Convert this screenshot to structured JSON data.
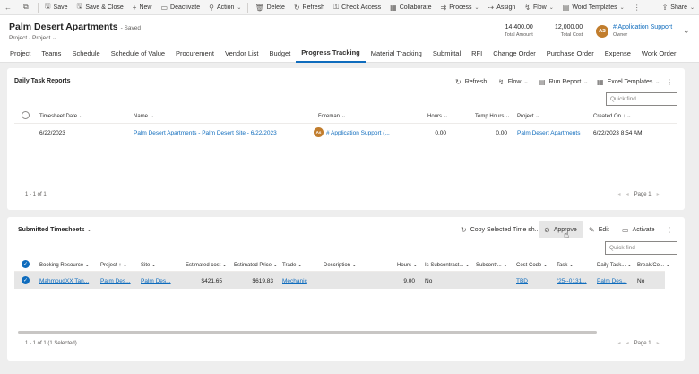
{
  "command_bar": {
    "items": [
      {
        "label": "",
        "icon": "back-arrow-icon"
      },
      {
        "label": "",
        "icon": "popout-icon"
      },
      {
        "label": "Save",
        "icon": "save-icon"
      },
      {
        "label": "Save & Close",
        "icon": "save-close-icon"
      },
      {
        "label": "New",
        "icon": "plus-icon"
      },
      {
        "label": "Deactivate",
        "icon": "document-icon"
      },
      {
        "label": "Action",
        "icon": "action-icon"
      },
      {
        "label": "Delete",
        "icon": "trash-icon"
      },
      {
        "label": "Refresh",
        "icon": "refresh-icon"
      },
      {
        "label": "Check Access",
        "icon": "check-access-icon"
      },
      {
        "label": "Collaborate",
        "icon": "collaborate-icon"
      },
      {
        "label": "Process",
        "icon": "process-icon"
      },
      {
        "label": "Assign",
        "icon": "assign-icon"
      },
      {
        "label": "Flow",
        "icon": "flow-icon"
      },
      {
        "label": "Word Templates",
        "icon": "word-icon"
      },
      {
        "label": "Share",
        "icon": "share-icon"
      }
    ]
  },
  "record": {
    "title": "Palm Desert Apartments",
    "status": "- Saved",
    "entity": "Project",
    "form": "Project",
    "total_amount_value": "14,400.00",
    "total_amount_label": "Total Amount",
    "total_cost_value": "12,000.00",
    "total_cost_label": "Total Cost",
    "owner_initials": "AS",
    "owner_name": "# Application Support",
    "owner_label": "Owner"
  },
  "tabs": [
    "Project",
    "Teams",
    "Schedule",
    "Schedule of Value",
    "Procurement",
    "Vendor List",
    "Budget",
    "Progress Tracking",
    "Material Tracking",
    "Submittal",
    "RFI",
    "Change Order",
    "Purchase Order",
    "Expense",
    "Work Order"
  ],
  "daily_reports": {
    "title": "Daily Task Reports",
    "toolbar": {
      "refresh": "Refresh",
      "flow": "Flow",
      "run_report": "Run Report",
      "excel_templates": "Excel Templates"
    },
    "quick_find_placeholder": "Quick find",
    "columns": {
      "timesheet_date": "Timesheet Date",
      "name": "Name",
      "foreman": "Foreman",
      "hours": "Hours",
      "temp_hours": "Temp Hours",
      "project": "Project",
      "created_on": "Created On"
    },
    "rows": [
      {
        "timesheet_date": "6/22/2023",
        "name": "Palm Desert Apartments - Palm Desert Site - 6/22/2023",
        "foreman_initials": "As",
        "foreman": "# Application Support (...",
        "hours": "0.00",
        "temp_hours": "0.00",
        "project": "Palm Desert Apartments",
        "created_on": "6/22/2023 8:54 AM"
      }
    ],
    "footer_count": "1 - 1 of 1",
    "page_label": "Page 1"
  },
  "timesheets": {
    "title": "Submitted Timesheets",
    "toolbar": {
      "copy": "Copy Selected Time sh...",
      "approve": "Approve",
      "edit": "Edit",
      "activate": "Activate"
    },
    "quick_find_placeholder": "Quick find",
    "columns": {
      "booking_resource": "Booking Resource",
      "project": "Project",
      "site": "Site",
      "estimated_cost": "Estimated cost",
      "estimated_price": "Estimated Price",
      "trade": "Trade",
      "description": "Description",
      "hours": "Hours",
      "is_subcontract": "Is Subcontract...",
      "subcontr": "Subcontr...",
      "cost_code": "Cost Code",
      "task": "Task",
      "daily_task": "Daily Task...",
      "break": "Break/Co..."
    },
    "rows": [
      {
        "booking_resource": "MahmoudXX Tan...",
        "project": "Palm Des...",
        "site": "Palm Des...",
        "estimated_cost": "$421.65",
        "estimated_price": "$619.83",
        "trade": "Mechanic",
        "description": "",
        "hours": "9.00",
        "is_subcontract": "No",
        "subcontr": "",
        "cost_code": "TBD",
        "task": "(25--0131...",
        "daily_task": "Palm Des...",
        "break": "No"
      }
    ],
    "footer_count": "1 - 1 of 1 (1 Selected)",
    "page_label": "Page 1"
  }
}
